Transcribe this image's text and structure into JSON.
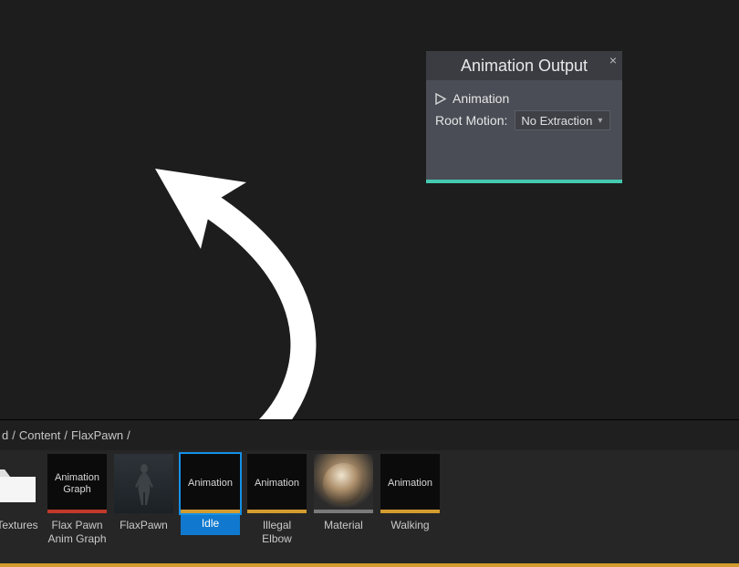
{
  "node": {
    "title": "Animation Output",
    "pin_label": "Animation",
    "root_motion_label": "Root Motion:",
    "root_motion_value": "No Extraction"
  },
  "breadcrumb": {
    "items": [
      "d",
      "Content",
      "FlaxPawn"
    ]
  },
  "assets": {
    "items": [
      {
        "kind": "folder",
        "thumb_text": "",
        "label": "Textures",
        "bar": "",
        "selected": false
      },
      {
        "kind": "anigraph",
        "thumb_text": "Animation Graph",
        "label": "Flax Pawn Anim Graph",
        "bar": "red",
        "selected": false
      },
      {
        "kind": "model",
        "thumb_text": "",
        "label": "FlaxPawn",
        "bar": "teal",
        "selected": false
      },
      {
        "kind": "animation",
        "thumb_text": "Animation",
        "label": "Idle",
        "bar": "amber",
        "selected": true
      },
      {
        "kind": "animation",
        "thumb_text": "Animation",
        "label": "Illegal Elbow",
        "bar": "amber",
        "selected": false
      },
      {
        "kind": "material",
        "thumb_text": "",
        "label": "Material",
        "bar": "grey",
        "selected": false
      },
      {
        "kind": "animation",
        "thumb_text": "Animation",
        "label": "Walking",
        "bar": "amber",
        "selected": false
      }
    ]
  }
}
